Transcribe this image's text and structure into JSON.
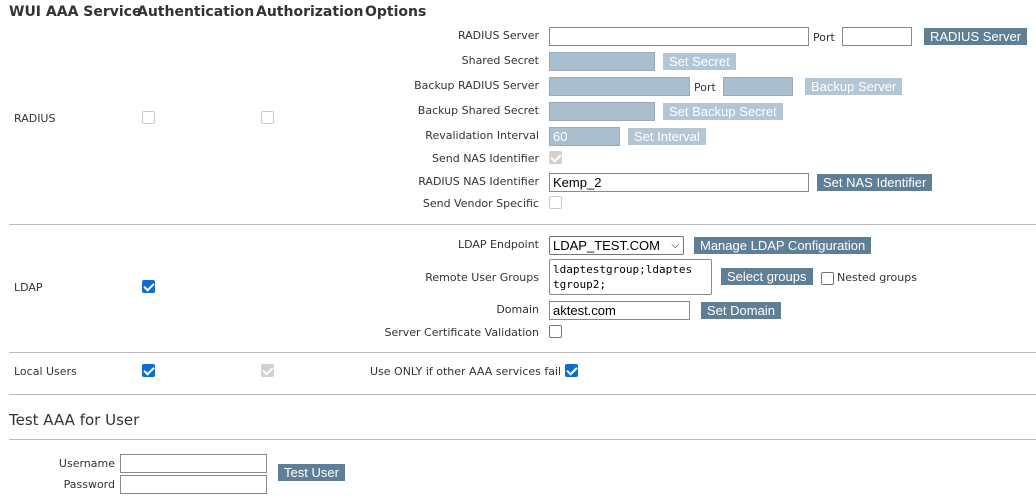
{
  "header": {
    "col1": "WUI AAA Service",
    "col2": "Authentication",
    "col3": "Authorization",
    "col4": "Options"
  },
  "radius": {
    "row_label": "RADIUS",
    "authentication_checked": false,
    "authorization_checked": false,
    "server_label": "RADIUS Server",
    "server_value": "",
    "port_label": "Port",
    "port_value": "",
    "server_button": "RADIUS Server",
    "shared_secret_label": "Shared Secret",
    "set_secret_button": "Set Secret",
    "backup_server_label": "Backup RADIUS Server",
    "backup_port_label": "Port",
    "backup_server_button": "Backup Server",
    "backup_secret_label": "Backup Shared Secret",
    "set_backup_secret_button": "Set Backup Secret",
    "revalidation_label": "Revalidation Interval",
    "revalidation_value": "60",
    "set_interval_button": "Set Interval",
    "send_nas_label": "Send NAS Identifier",
    "nas_identifier_label": "RADIUS NAS Identifier",
    "nas_identifier_value": "Kemp_2",
    "set_nas_button": "Set NAS Identifier",
    "send_vendor_label": "Send Vendor Specific"
  },
  "ldap": {
    "row_label": "LDAP",
    "authentication_checked": true,
    "endpoint_label": "LDAP Endpoint",
    "endpoint_value": "LDAP_TEST.COM",
    "manage_button": "Manage LDAP Configuration",
    "remote_groups_label": "Remote User Groups",
    "remote_groups_value": "ldaptestgroup;ldaptes\ntgroup2;",
    "select_groups_button": "Select groups",
    "nested_groups_label": "Nested groups",
    "domain_label": "Domain",
    "domain_value": "aktest.com",
    "set_domain_button": "Set Domain",
    "cert_validation_label": "Server Certificate Validation"
  },
  "local_users": {
    "row_label": "Local Users",
    "use_only_label": "Use ONLY if other AAA services fail"
  },
  "test": {
    "title": "Test AAA for User",
    "username_label": "Username",
    "password_label": "Password",
    "test_button": "Test User"
  },
  "colors": {
    "button": "#5e7f96",
    "button_disabled": "#b2c6d5",
    "input_disabled": "#a9bfd0",
    "checkbox_checked": "#0a6ed1"
  }
}
